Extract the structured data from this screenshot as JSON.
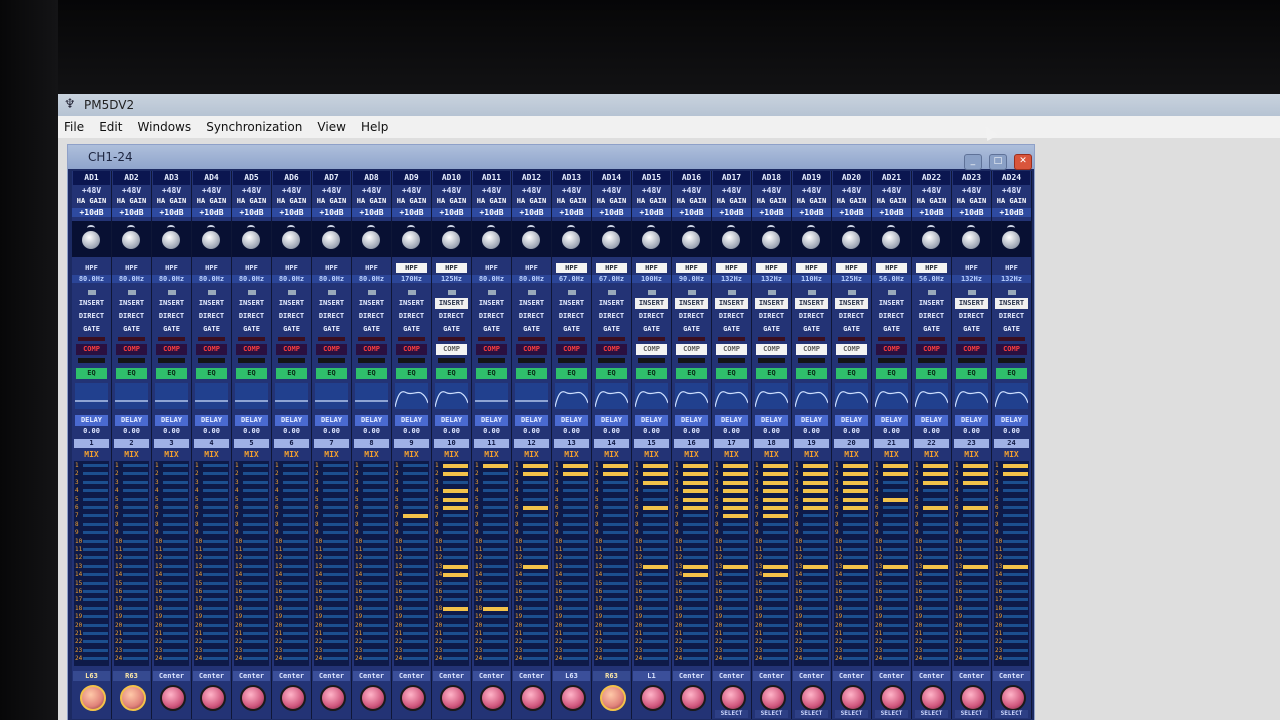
{
  "app": {
    "title": "PM5DV2"
  },
  "menu": [
    "File",
    "Edit",
    "Windows",
    "Synchronization",
    "View",
    "Help"
  ],
  "window": {
    "title": "CH1-24"
  },
  "labels": {
    "phantom": "+48V",
    "ha_gain": "HA GAIN",
    "gain": "+10dB",
    "hpf": "HPF",
    "insert": "INSERT",
    "direct": "DIRECT",
    "gate": "GATE",
    "comp": "COMP",
    "eq": "EQ",
    "delay": "DELAY",
    "delay_value": "0.00",
    "mix": "MIX",
    "select": "SELECT"
  },
  "channels": [
    {
      "name": "AD1",
      "num": "1",
      "hpf_on": false,
      "freq": "80.0Hz",
      "insert_on": false,
      "comp_on": false,
      "pan": "L63",
      "buses": [],
      "select": ""
    },
    {
      "name": "AD2",
      "num": "2",
      "hpf_on": false,
      "freq": "80.0Hz",
      "insert_on": false,
      "comp_on": false,
      "pan": "R63",
      "buses": [],
      "select": ""
    },
    {
      "name": "AD3",
      "num": "3",
      "hpf_on": false,
      "freq": "80.0Hz",
      "insert_on": false,
      "comp_on": false,
      "pan": "Center",
      "buses": [],
      "select": ""
    },
    {
      "name": "AD4",
      "num": "4",
      "hpf_on": false,
      "freq": "80.0Hz",
      "insert_on": false,
      "comp_on": false,
      "pan": "Center",
      "buses": [],
      "select": ""
    },
    {
      "name": "AD5",
      "num": "5",
      "hpf_on": false,
      "freq": "80.0Hz",
      "insert_on": false,
      "comp_on": false,
      "pan": "Center",
      "buses": [],
      "select": ""
    },
    {
      "name": "AD6",
      "num": "6",
      "hpf_on": false,
      "freq": "80.0Hz",
      "insert_on": false,
      "comp_on": false,
      "pan": "Center",
      "buses": [],
      "select": ""
    },
    {
      "name": "AD7",
      "num": "7",
      "hpf_on": false,
      "freq": "80.0Hz",
      "insert_on": false,
      "comp_on": false,
      "pan": "Center",
      "buses": [],
      "select": ""
    },
    {
      "name": "AD8",
      "num": "8",
      "hpf_on": false,
      "freq": "80.0Hz",
      "insert_on": false,
      "comp_on": false,
      "pan": "Center",
      "buses": [],
      "select": ""
    },
    {
      "name": "AD9",
      "num": "9",
      "hpf_on": true,
      "freq": "170Hz",
      "insert_on": false,
      "comp_on": false,
      "pan": "Center",
      "buses": [
        6
      ],
      "select": ""
    },
    {
      "name": "AD10",
      "num": "10",
      "hpf_on": true,
      "freq": "125Hz",
      "insert_on": true,
      "comp_on": true,
      "pan": "Center",
      "buses": [
        0,
        1,
        3,
        4,
        5,
        12,
        13,
        17
      ],
      "select": ""
    },
    {
      "name": "AD11",
      "num": "11",
      "hpf_on": false,
      "freq": "80.0Hz",
      "insert_on": false,
      "comp_on": false,
      "pan": "Center",
      "buses": [
        0,
        17
      ],
      "select": ""
    },
    {
      "name": "AD12",
      "num": "12",
      "hpf_on": false,
      "freq": "80.0Hz",
      "insert_on": false,
      "comp_on": false,
      "pan": "Center",
      "buses": [
        0,
        1,
        5,
        12
      ],
      "select": ""
    },
    {
      "name": "AD13",
      "num": "13",
      "hpf_on": true,
      "freq": "67.0Hz",
      "insert_on": false,
      "comp_on": false,
      "pan": "L63",
      "buses": [
        0,
        1
      ],
      "select": ""
    },
    {
      "name": "AD14",
      "num": "14",
      "hpf_on": true,
      "freq": "67.0Hz",
      "insert_on": false,
      "comp_on": false,
      "pan": "R63",
      "buses": [
        0,
        1
      ],
      "select": ""
    },
    {
      "name": "AD15",
      "num": "15",
      "hpf_on": true,
      "freq": "100Hz",
      "insert_on": true,
      "comp_on": true,
      "pan": "L1",
      "buses": [
        0,
        1,
        2,
        5,
        12
      ],
      "select": ""
    },
    {
      "name": "AD16",
      "num": "16",
      "hpf_on": true,
      "freq": "90.0Hz",
      "insert_on": true,
      "comp_on": true,
      "pan": "Center",
      "buses": [
        0,
        1,
        2,
        3,
        4,
        5,
        12,
        13
      ],
      "select": ""
    },
    {
      "name": "AD17",
      "num": "17",
      "hpf_on": true,
      "freq": "132Hz",
      "insert_on": true,
      "comp_on": true,
      "pan": "Center",
      "buses": [
        0,
        1,
        2,
        3,
        4,
        5,
        6,
        12
      ],
      "select": "SELECT"
    },
    {
      "name": "AD18",
      "num": "18",
      "hpf_on": true,
      "freq": "132Hz",
      "insert_on": true,
      "comp_on": true,
      "pan": "Center",
      "buses": [
        0,
        1,
        2,
        3,
        4,
        5,
        6,
        12,
        13
      ],
      "select": "SELECT"
    },
    {
      "name": "AD19",
      "num": "19",
      "hpf_on": true,
      "freq": "110Hz",
      "insert_on": true,
      "comp_on": true,
      "pan": "Center",
      "buses": [
        0,
        1,
        2,
        3,
        4,
        5,
        12
      ],
      "select": "SELECT"
    },
    {
      "name": "AD20",
      "num": "20",
      "hpf_on": true,
      "freq": "125Hz",
      "insert_on": true,
      "comp_on": true,
      "pan": "Center",
      "buses": [
        0,
        1,
        2,
        3,
        4,
        5,
        12
      ],
      "select": "SELECT"
    },
    {
      "name": "AD21",
      "num": "21",
      "hpf_on": true,
      "freq": "56.0Hz",
      "insert_on": false,
      "comp_on": false,
      "pan": "Center",
      "buses": [
        0,
        1,
        4,
        12
      ],
      "select": "SELECT"
    },
    {
      "name": "AD22",
      "num": "22",
      "hpf_on": true,
      "freq": "56.0Hz",
      "insert_on": false,
      "comp_on": false,
      "pan": "Center",
      "buses": [
        0,
        1,
        2,
        5,
        12
      ],
      "select": "SELECT"
    },
    {
      "name": "AD23",
      "num": "23",
      "hpf_on": false,
      "freq": "132Hz",
      "insert_on": true,
      "comp_on": false,
      "pan": "Center",
      "buses": [
        0,
        1,
        2,
        5,
        12
      ],
      "select": "SELECT"
    },
    {
      "name": "AD24",
      "num": "24",
      "hpf_on": false,
      "freq": "132Hz",
      "insert_on": true,
      "comp_on": false,
      "pan": "Center",
      "buses": [
        0,
        1,
        12
      ],
      "select": "SELECT"
    }
  ],
  "bus_numbers": [
    "1",
    "2",
    "3",
    "4",
    "5",
    "6",
    "7",
    "8",
    "9",
    "10",
    "11",
    "12",
    "13",
    "14",
    "15",
    "16",
    "17",
    "18",
    "19",
    "20",
    "21",
    "22",
    "23",
    "24"
  ],
  "icons": {
    "app": "yamaha-tuning-fork-icon",
    "minimize": "minimize-icon",
    "maximize": "maximize-icon",
    "close": "close-icon"
  },
  "colors": {
    "strip_bg": "#233375",
    "bus_on": "#f2c24a",
    "eq": "#2fbf6b",
    "comp_off": "#ff3d3d"
  }
}
